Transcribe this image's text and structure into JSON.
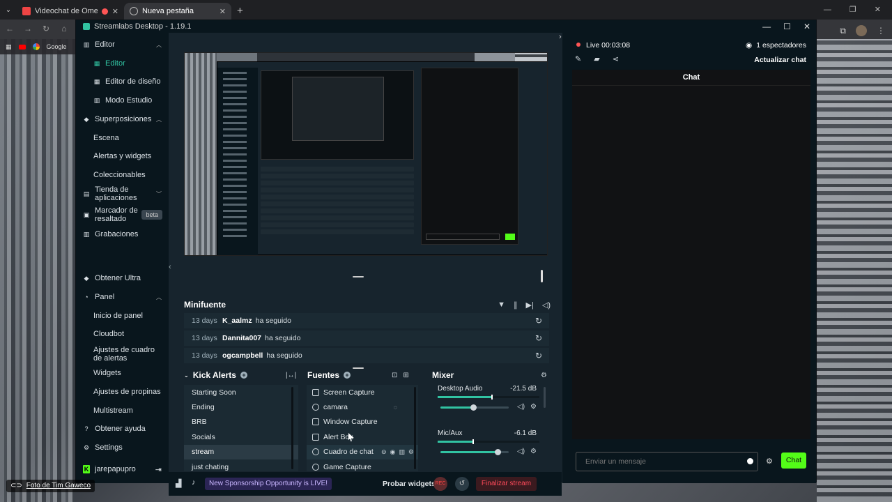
{
  "browser": {
    "tabs": [
      {
        "title": "Videochat de OmeTV: uno",
        "active": false
      },
      {
        "title": "Nueva pestaña",
        "active": true
      }
    ],
    "bookmarks": [
      "Google"
    ]
  },
  "app": {
    "title": "Streamlabs Desktop - 1.19.1"
  },
  "sidebar": {
    "editor": "Editor",
    "editor_active": "Editor",
    "design_editor": "Editor de diseño",
    "studio_mode": "Modo Estudio",
    "overlays": "Superposiciones",
    "scene": "Escena",
    "alerts_widgets": "Alertas y widgets",
    "collectibles": "Coleccionables",
    "app_store": "Tienda de aplicaciones",
    "highlighter": "Marcador de resaltado",
    "beta": "beta",
    "recordings": "Grabaciones",
    "get_ultra": "Obtener Ultra",
    "panel": "Panel",
    "panel_home": "Inicio de panel",
    "cloudbot": "Cloudbot",
    "chatbox_settings": "Ajustes de cuadro de alertas",
    "widgets": "Widgets",
    "tip_settings": "Ajustes de propinas",
    "multistream": "Multistream",
    "get_help": "Obtener ayuda",
    "settings": "Settings",
    "user": "jarepapupro"
  },
  "minifeed": {
    "title": "Minifuente",
    "events": [
      {
        "ago": "13 days",
        "user": "K_aalmz",
        "action": "ha seguido"
      },
      {
        "ago": "13 days",
        "user": "Dannita007",
        "action": "ha seguido"
      },
      {
        "ago": "13 days",
        "user": "ogcampbell",
        "action": "ha seguido"
      }
    ]
  },
  "scenes": {
    "title": "Kick Alerts",
    "items": [
      "Starting Soon",
      "Ending",
      "BRB",
      "Socials",
      "stream",
      "just chating"
    ],
    "selected": "stream"
  },
  "sources": {
    "title": "Fuentes",
    "items": [
      "Screen Capture",
      "camara",
      "Window Capture",
      "Alert Box",
      "Cuadro de chat",
      "Game Capture"
    ],
    "selected": "Cuadro de chat"
  },
  "mixer": {
    "title": "Mixer",
    "channels": [
      {
        "name": "Desktop Audio",
        "db": "-21.5 dB",
        "level": 0.53,
        "volume": 0.48
      },
      {
        "name": "Mic/Aux",
        "db": "-6.1 dB",
        "level": 0.34,
        "volume": 0.84
      }
    ]
  },
  "footer": {
    "sponsor": "New Sponsorship Opportunity is LIVE!",
    "test_widgets": "Probar widgets",
    "rec": "REC",
    "end_stream": "Finalizar stream"
  },
  "live": {
    "status": "Live 00:03:08",
    "viewers": "1 espectadores",
    "refresh_chat": "Actualizar chat",
    "chat_title": "Chat",
    "input_placeholder": "Enviar un mensaje",
    "send": "Chat"
  },
  "credit": {
    "text": "Foto de Tim Gaweco"
  }
}
